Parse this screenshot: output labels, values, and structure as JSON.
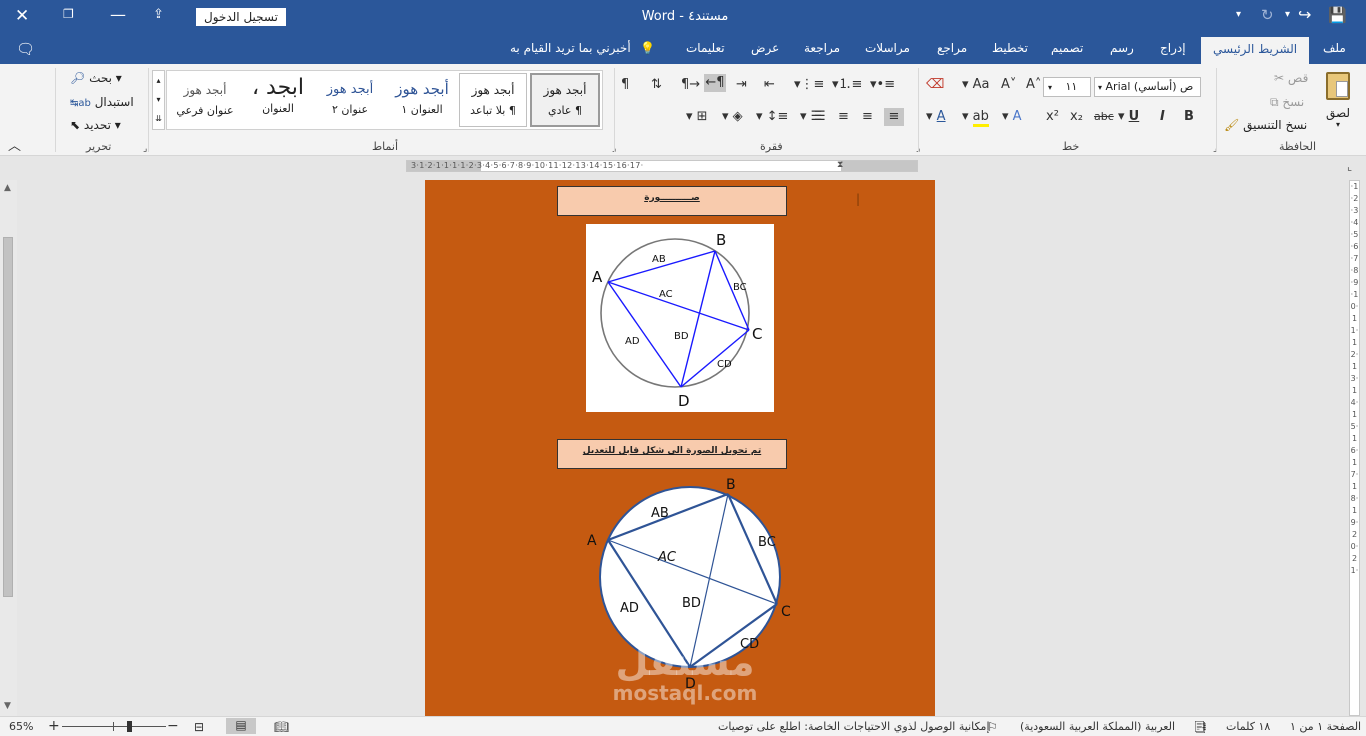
{
  "window": {
    "title": "مستند٤  -  Word",
    "sign_in": "تسجيل الدخول"
  },
  "tabs": [
    "ملف",
    "الشريط الرئيسي",
    "إدراج",
    "رسم",
    "تصميم",
    "تخطيط",
    "مراجع",
    "مراسلات",
    "مراجعة",
    "عرض",
    "تعليمات"
  ],
  "tell_me": "أخبرني بما تريد القيام به",
  "clipboard": {
    "paste": "لصق",
    "cut": "قص",
    "copy": "نسخ",
    "format_painter": "نسخ التنسيق",
    "group": "الحافظة"
  },
  "font": {
    "name": "Arial (أساسي) ص",
    "size": "١١",
    "group": "خط"
  },
  "paragraph": {
    "group": "فقرة"
  },
  "styles": {
    "group": "أنماط",
    "items": [
      {
        "preview": "أبجد هوز",
        "name": "¶ عادي"
      },
      {
        "preview": "أبجد هوز",
        "name": "¶ بلا تباعد"
      },
      {
        "preview": "أبجد هوز",
        "name": "العنوان ١"
      },
      {
        "preview": "أبجد هوز",
        "name": "عنوان ٢"
      },
      {
        "preview": "ابجد ،",
        "name": "العنوان"
      },
      {
        "preview": "أبجد هوز",
        "name": "عنوان فرعي"
      }
    ]
  },
  "editing": {
    "find": "بحث",
    "replace": "استبدال",
    "select": "تحديد",
    "group": "تحرير"
  },
  "ruler_h": "3·1·2·1·1·1·1·2·3·4·5·6·7·8·9·10·11·12·13·14·15·16·17·",
  "ruler_v": "·1·2·3·4·5·6·7·8·9·10·11·12·13·14·15·16·17·18·19·20·21·",
  "document": {
    "label1": "صــــــــــورة",
    "label2": "تم تحويل الصورة الى شكل قابل للتعديل",
    "diagram1": {
      "points": [
        "A",
        "B",
        "C",
        "D"
      ],
      "chords": [
        "AB",
        "BC",
        "CD",
        "AD",
        "AC",
        "BD"
      ]
    },
    "diagram2": {
      "points": [
        "A",
        "B",
        "C",
        "D"
      ],
      "chords": [
        "AB",
        "BC",
        "CD",
        "AD",
        "AC",
        "BD"
      ]
    },
    "watermark_ar": "مستقل",
    "watermark_en": "mostaql.com"
  },
  "status": {
    "page": "الصفحة ١ من ١",
    "words": "١٨ كلمات",
    "language": "العربية (المملكة العربية السعودية)",
    "accessibility": "إمكانية الوصول لذوي الاحتياجات الخاصة: اطلع على توصيات",
    "zoom": "65%",
    "zoom_minus": "−",
    "zoom_plus": "+"
  },
  "colors": {
    "brand": "#2b579a",
    "page_bg": "#c55a11",
    "label_bg": "#f8cbad",
    "line_blue": "#1a1aff",
    "line_dark": "#2f5496"
  }
}
